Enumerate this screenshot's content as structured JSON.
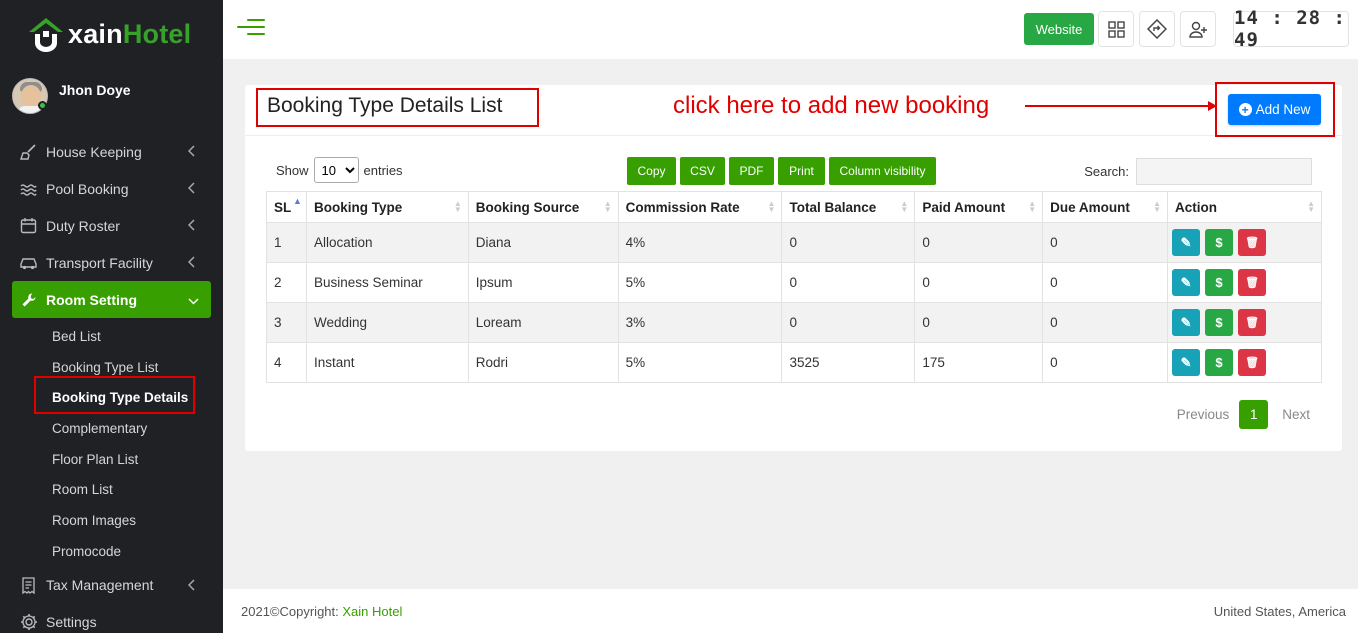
{
  "app": {
    "logo_prefix": "xain",
    "logo_suffix": "Hotel",
    "brand_color": "#37a000"
  },
  "user": {
    "name": "Jhon Doye",
    "status": "online"
  },
  "sidebar": {
    "items": [
      {
        "label": "House Keeping",
        "icon": "broom-icon"
      },
      {
        "label": "Pool Booking",
        "icon": "waves-icon"
      },
      {
        "label": "Duty Roster",
        "icon": "calendar-icon"
      },
      {
        "label": "Transport Facility",
        "icon": "car-icon"
      },
      {
        "label": "Room Setting",
        "icon": "wrench-icon"
      },
      {
        "label": "Tax Management",
        "icon": "receipt-icon"
      },
      {
        "label": "Settings",
        "icon": "gear-icon"
      }
    ],
    "room_setting_sub": [
      "Bed List",
      "Booking Type List",
      "Booking Type Details",
      "Complementary",
      "Floor Plan List",
      "Room List",
      "Room Images",
      "Promocode"
    ]
  },
  "topbar": {
    "website_label": "Website",
    "clock": "14 : 28 : 49"
  },
  "page": {
    "title": "Booking Type Details List",
    "annotation": "click here to add new booking",
    "add_new_label": "Add New"
  },
  "table_controls": {
    "show_label": "Show",
    "entries_value": "10",
    "entries_label": "entries",
    "export_buttons": [
      "Copy",
      "CSV",
      "PDF",
      "Print",
      "Column visibility"
    ],
    "search_label": "Search:"
  },
  "table": {
    "columns": [
      "SL",
      "Booking Type",
      "Booking Source",
      "Commission Rate",
      "Total Balance",
      "Paid Amount",
      "Due Amount",
      "Action"
    ],
    "rows": [
      [
        "1",
        "Allocation",
        "Diana",
        "4%",
        "0",
        "0",
        "0"
      ],
      [
        "2",
        "Business Seminar",
        "Ipsum",
        "5%",
        "0",
        "0",
        "0"
      ],
      [
        "3",
        "Wedding",
        "Loream",
        "3%",
        "0",
        "0",
        "0"
      ],
      [
        "4",
        "Instant",
        "Rodri",
        "5%",
        "3525",
        "175",
        "0"
      ]
    ],
    "action_glyphs": {
      "edit": "✎",
      "pay": "$",
      "delete": "🗑"
    }
  },
  "pagination": {
    "previous": "Previous",
    "current": "1",
    "next": "Next"
  },
  "footer": {
    "copyright": "2021©Copyright: ",
    "brand": "Xain Hotel",
    "location": "United States, America"
  }
}
